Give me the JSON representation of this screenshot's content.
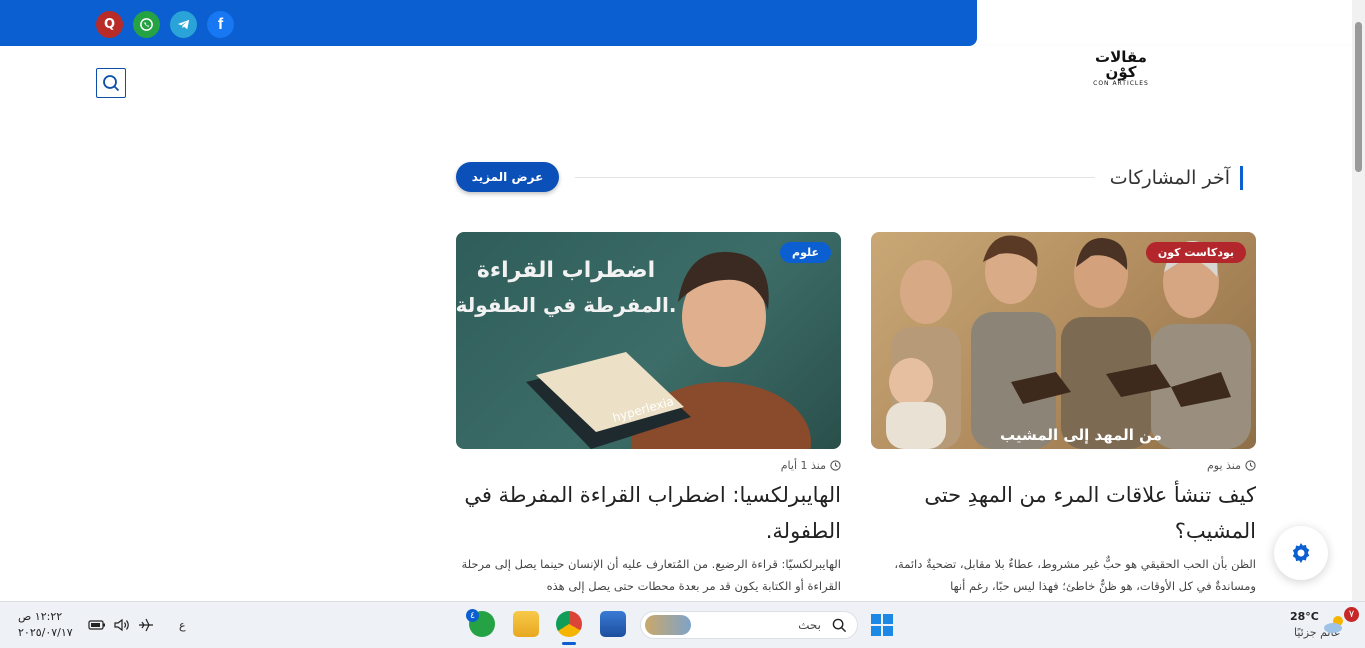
{
  "site": {
    "logo_ar": "مقالات كوْن",
    "logo_en": "CON ARTICLES",
    "social": [
      {
        "name": "quora",
        "glyph": "Q",
        "color": "#b92b27"
      },
      {
        "name": "whatsapp",
        "glyph": "✆",
        "color": "#25a244"
      },
      {
        "name": "telegram",
        "glyph": "➤",
        "color": "#2aa3d9"
      },
      {
        "name": "facebook",
        "glyph": "f",
        "color": "#1877f2"
      }
    ]
  },
  "section": {
    "title": "آخر المشاركات",
    "more_label": "عرض المزيد"
  },
  "cards": [
    {
      "badge": "علوم",
      "badge_color": "#0b5fd0",
      "time": "منذ 1 أيام",
      "title": "الهايبرلكسيا: اضطراب القراءة المفرطة في الطفولة.",
      "excerpt": "الهايبرلكسيّا: قراءة الرضيع. من المُتعارف عليه أن الإنسان حينما يصل إلى مرحلة القراءة أو الكتابة يكون قد مر بعدة محطات حتى يصل إلى هذه",
      "img_text_line1": "اضطراب القراءة",
      "img_text_line2": "المفرطة في الطفولة.",
      "book_label": "hyperlexia"
    },
    {
      "badge": "بودكاست كون",
      "badge_color": "#b3262b",
      "time": "منذ يوم",
      "title": "كيف تنشأ علاقات المرء من المهدِ حتى المشيب؟",
      "excerpt": "الظن بأن الحب الحقيقي هو حبٌّ غير مشروط، عطاءٌ بلا مقابل، تضحيةٌ دائمة، ومساندةٌ في كل الأوقات، هو ظنٌّ خاطئ؛ فهذا ليس حبًا، رغم أنها",
      "img_caption": "من المهد إلى المشيب"
    }
  ],
  "taskbar": {
    "weather_temp": "28°C",
    "weather_desc": "غائم جزئيًا",
    "weather_badge": "٧",
    "search_placeholder": "بحث",
    "whatsapp_badge": "٤",
    "lang": "ع",
    "time": "١٢:٢٢ ص",
    "date": "٢٠٢٥/٠٧/١٧"
  }
}
